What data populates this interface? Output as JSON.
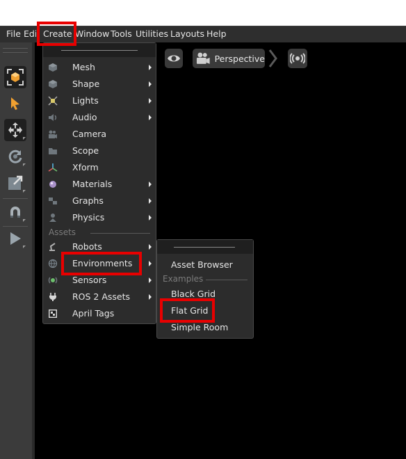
{
  "menubar": {
    "items": [
      "File",
      "Edit",
      "Create",
      "Window",
      "Tools",
      "Utilities",
      "Layouts",
      "Help"
    ]
  },
  "viewport": {
    "camera_label": "Perspective"
  },
  "create_menu": {
    "items": [
      {
        "label": "Mesh",
        "icon": "mesh-cube-icon",
        "submenu": true
      },
      {
        "label": "Shape",
        "icon": "shape-cube-icon",
        "submenu": true
      },
      {
        "label": "Lights",
        "icon": "light-icon",
        "submenu": true
      },
      {
        "label": "Audio",
        "icon": "speaker-icon",
        "submenu": true
      },
      {
        "label": "Camera",
        "icon": "camera-icon",
        "submenu": false
      },
      {
        "label": "Scope",
        "icon": "folder-icon",
        "submenu": false
      },
      {
        "label": "Xform",
        "icon": "xform-axes-icon",
        "submenu": false
      },
      {
        "label": "Materials",
        "icon": "material-sphere-icon",
        "submenu": true
      },
      {
        "label": "Graphs",
        "icon": "graph-icon",
        "submenu": true
      },
      {
        "label": "Physics",
        "icon": "physics-icon",
        "submenu": true
      }
    ],
    "assets_section": "Assets",
    "asset_items": [
      {
        "label": "Robots",
        "icon": "robot-arm-icon",
        "submenu": true
      },
      {
        "label": "Environments",
        "icon": "globe-icon",
        "submenu": true
      },
      {
        "label": "Sensors",
        "icon": "sensor-icon",
        "submenu": true
      },
      {
        "label": "ROS 2 Assets",
        "icon": "plug-icon",
        "submenu": true
      },
      {
        "label": "April Tags",
        "icon": "apriltag-icon",
        "submenu": false
      }
    ]
  },
  "environments_menu": {
    "asset_browser": "Asset Browser",
    "examples_section": "Examples",
    "items": [
      "Black Grid",
      "Flat Grid",
      "Simple Room"
    ]
  },
  "colors": {
    "highlight": "#e80000",
    "menu_bg": "#2c2c2c",
    "toolbar_bg": "#3b3b3b",
    "select_orange": "#f0a030"
  }
}
